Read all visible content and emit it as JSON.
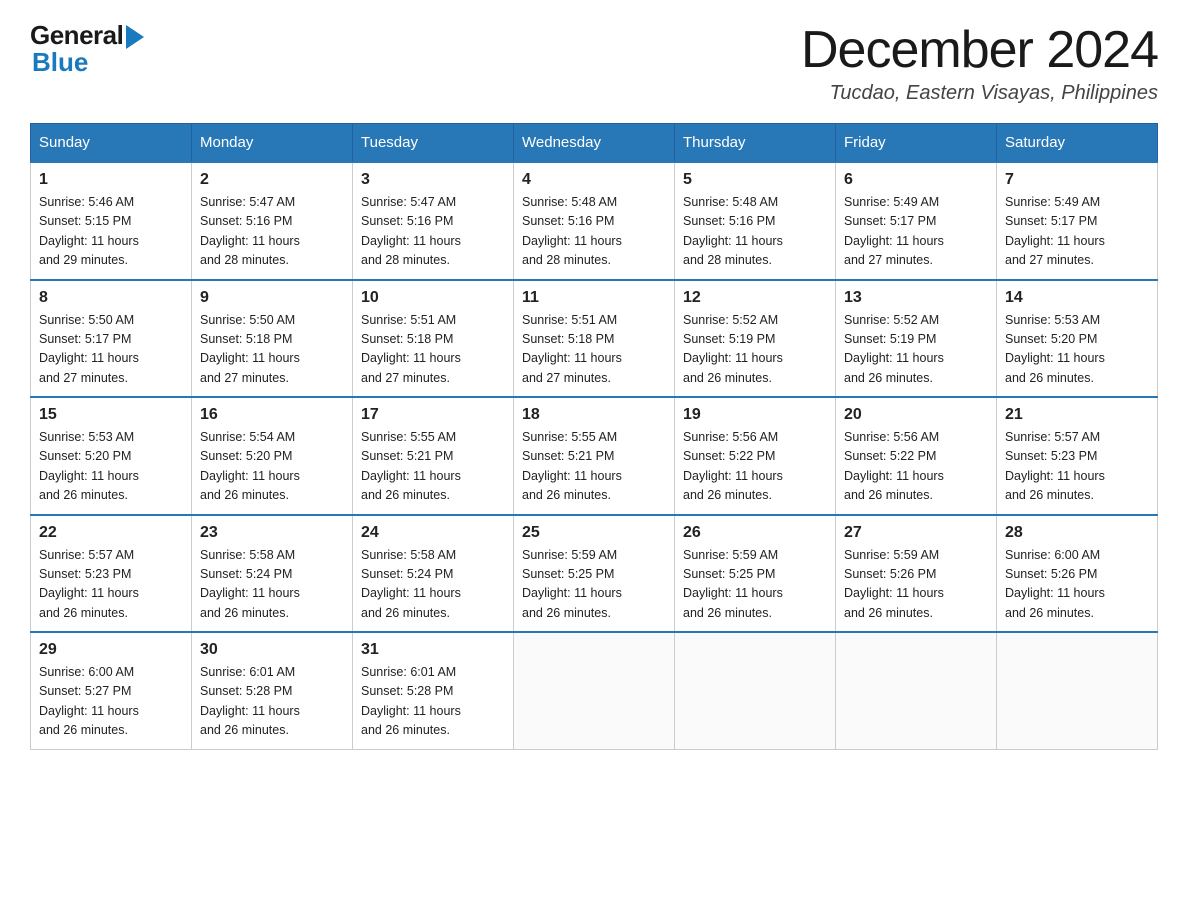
{
  "logo": {
    "general": "General",
    "blue": "Blue"
  },
  "title": "December 2024",
  "location": "Tucdao, Eastern Visayas, Philippines",
  "weekdays": [
    "Sunday",
    "Monday",
    "Tuesday",
    "Wednesday",
    "Thursday",
    "Friday",
    "Saturday"
  ],
  "weeks": [
    [
      {
        "day": "1",
        "sunrise": "5:46 AM",
        "sunset": "5:15 PM",
        "daylight": "11 hours and 29 minutes."
      },
      {
        "day": "2",
        "sunrise": "5:47 AM",
        "sunset": "5:16 PM",
        "daylight": "11 hours and 28 minutes."
      },
      {
        "day": "3",
        "sunrise": "5:47 AM",
        "sunset": "5:16 PM",
        "daylight": "11 hours and 28 minutes."
      },
      {
        "day": "4",
        "sunrise": "5:48 AM",
        "sunset": "5:16 PM",
        "daylight": "11 hours and 28 minutes."
      },
      {
        "day": "5",
        "sunrise": "5:48 AM",
        "sunset": "5:16 PM",
        "daylight": "11 hours and 28 minutes."
      },
      {
        "day": "6",
        "sunrise": "5:49 AM",
        "sunset": "5:17 PM",
        "daylight": "11 hours and 27 minutes."
      },
      {
        "day": "7",
        "sunrise": "5:49 AM",
        "sunset": "5:17 PM",
        "daylight": "11 hours and 27 minutes."
      }
    ],
    [
      {
        "day": "8",
        "sunrise": "5:50 AM",
        "sunset": "5:17 PM",
        "daylight": "11 hours and 27 minutes."
      },
      {
        "day": "9",
        "sunrise": "5:50 AM",
        "sunset": "5:18 PM",
        "daylight": "11 hours and 27 minutes."
      },
      {
        "day": "10",
        "sunrise": "5:51 AM",
        "sunset": "5:18 PM",
        "daylight": "11 hours and 27 minutes."
      },
      {
        "day": "11",
        "sunrise": "5:51 AM",
        "sunset": "5:18 PM",
        "daylight": "11 hours and 27 minutes."
      },
      {
        "day": "12",
        "sunrise": "5:52 AM",
        "sunset": "5:19 PM",
        "daylight": "11 hours and 26 minutes."
      },
      {
        "day": "13",
        "sunrise": "5:52 AM",
        "sunset": "5:19 PM",
        "daylight": "11 hours and 26 minutes."
      },
      {
        "day": "14",
        "sunrise": "5:53 AM",
        "sunset": "5:20 PM",
        "daylight": "11 hours and 26 minutes."
      }
    ],
    [
      {
        "day": "15",
        "sunrise": "5:53 AM",
        "sunset": "5:20 PM",
        "daylight": "11 hours and 26 minutes."
      },
      {
        "day": "16",
        "sunrise": "5:54 AM",
        "sunset": "5:20 PM",
        "daylight": "11 hours and 26 minutes."
      },
      {
        "day": "17",
        "sunrise": "5:55 AM",
        "sunset": "5:21 PM",
        "daylight": "11 hours and 26 minutes."
      },
      {
        "day": "18",
        "sunrise": "5:55 AM",
        "sunset": "5:21 PM",
        "daylight": "11 hours and 26 minutes."
      },
      {
        "day": "19",
        "sunrise": "5:56 AM",
        "sunset": "5:22 PM",
        "daylight": "11 hours and 26 minutes."
      },
      {
        "day": "20",
        "sunrise": "5:56 AM",
        "sunset": "5:22 PM",
        "daylight": "11 hours and 26 minutes."
      },
      {
        "day": "21",
        "sunrise": "5:57 AM",
        "sunset": "5:23 PM",
        "daylight": "11 hours and 26 minutes."
      }
    ],
    [
      {
        "day": "22",
        "sunrise": "5:57 AM",
        "sunset": "5:23 PM",
        "daylight": "11 hours and 26 minutes."
      },
      {
        "day": "23",
        "sunrise": "5:58 AM",
        "sunset": "5:24 PM",
        "daylight": "11 hours and 26 minutes."
      },
      {
        "day": "24",
        "sunrise": "5:58 AM",
        "sunset": "5:24 PM",
        "daylight": "11 hours and 26 minutes."
      },
      {
        "day": "25",
        "sunrise": "5:59 AM",
        "sunset": "5:25 PM",
        "daylight": "11 hours and 26 minutes."
      },
      {
        "day": "26",
        "sunrise": "5:59 AM",
        "sunset": "5:25 PM",
        "daylight": "11 hours and 26 minutes."
      },
      {
        "day": "27",
        "sunrise": "5:59 AM",
        "sunset": "5:26 PM",
        "daylight": "11 hours and 26 minutes."
      },
      {
        "day": "28",
        "sunrise": "6:00 AM",
        "sunset": "5:26 PM",
        "daylight": "11 hours and 26 minutes."
      }
    ],
    [
      {
        "day": "29",
        "sunrise": "6:00 AM",
        "sunset": "5:27 PM",
        "daylight": "11 hours and 26 minutes."
      },
      {
        "day": "30",
        "sunrise": "6:01 AM",
        "sunset": "5:28 PM",
        "daylight": "11 hours and 26 minutes."
      },
      {
        "day": "31",
        "sunrise": "6:01 AM",
        "sunset": "5:28 PM",
        "daylight": "11 hours and 26 minutes."
      },
      null,
      null,
      null,
      null
    ]
  ]
}
